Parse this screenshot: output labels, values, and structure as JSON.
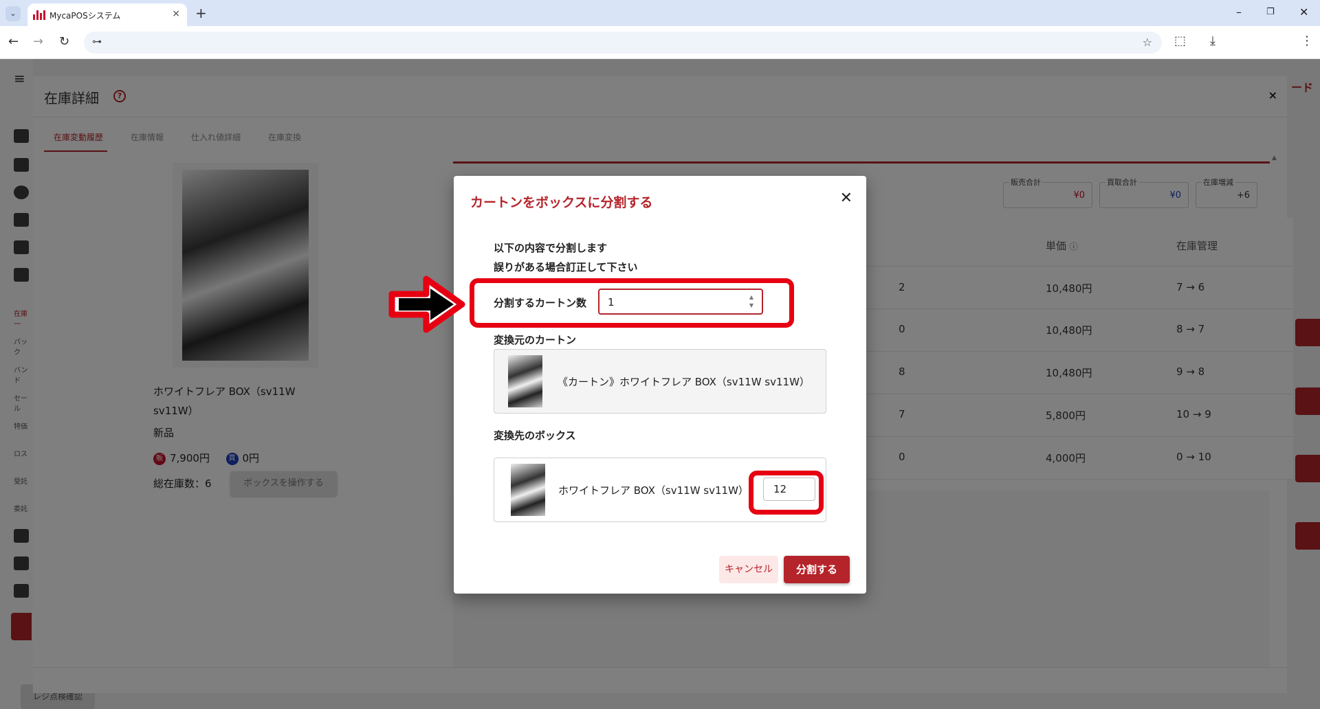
{
  "browser": {
    "tab_title": "MycaPOSシステム",
    "tab_close": "×",
    "new_tab": "+",
    "window_minimize": "–",
    "window_restore": "❐",
    "window_close": "✕",
    "nav_back": "←",
    "nav_forward": "→",
    "nav_reload": "↻",
    "site_info": "⊶",
    "bookmark_star": "☆",
    "extensions": "⬚",
    "download": "⤓",
    "menu": "⋮",
    "tab_menu": "⌄"
  },
  "app": {
    "hamburger": "≡",
    "right_header_text": "ード",
    "sidebar_labels": [
      "在庫一",
      "パック",
      "バンド",
      "セール",
      "特価",
      "ロス",
      "受託",
      "委託"
    ],
    "bottom_button": "レジ点検確認"
  },
  "panel": {
    "title": "在庫詳細",
    "help": "?",
    "close": "×",
    "tabs": [
      "在庫変動履歴",
      "在庫情報",
      "仕入れ値詳細",
      "在庫変換"
    ],
    "product": {
      "name": "ホワイトフレア BOX（sv11W sv11W）",
      "condition": "新品",
      "sell_badge": "販",
      "sell_price": "7,900円",
      "buy_badge": "買",
      "buy_price": "0円",
      "total_stock": "総在庫数：6",
      "operate_button": "ボックスを操作する"
    },
    "summary": [
      {
        "label": "販売合計",
        "value": "¥0",
        "color": "#c8102e"
      },
      {
        "label": "買取合計",
        "value": "¥0",
        "color": "#1a3fbf"
      },
      {
        "label": "在庫増減",
        "value": "+6",
        "color": "#333333"
      }
    ],
    "table": {
      "headers": [
        "単価",
        "在庫管理"
      ],
      "unit_price_info_icon": "ⓘ",
      "rows": [
        {
          "qty": "2",
          "unit_price": "10,480円",
          "stock": "7 → 6"
        },
        {
          "qty": "0",
          "unit_price": "10,480円",
          "stock": "8 → 7"
        },
        {
          "qty": "8",
          "unit_price": "10,480円",
          "stock": "9 → 8"
        },
        {
          "qty": "7",
          "unit_price": "5,800円",
          "stock": "10 → 9"
        },
        {
          "qty": "0",
          "unit_price": "4,000円",
          "stock": "0 → 10"
        }
      ]
    },
    "scroll_up": "▲",
    "scroll_down": "▼"
  },
  "modal": {
    "title": "カートンをボックスに分割する",
    "close": "✕",
    "intro_line1": "以下の内容で分割します",
    "intro_line2": "誤りがある場合訂正して下さい",
    "carton_count_label": "分割するカートン数",
    "carton_count_value": "1",
    "spin_up": "▲",
    "spin_down": "▼",
    "source_label": "変換元のカートン",
    "source_item": "《カートン》ホワイトフレア BOX（sv11W sv11W）",
    "target_label": "変換先のボックス",
    "target_item": "ホワイトフレア BOX（sv11W sv11W）",
    "target_qty": "12",
    "cancel": "キャンセル",
    "submit": "分割する"
  },
  "colors": {
    "accent": "#b5242b",
    "highlight": "#e60012"
  }
}
